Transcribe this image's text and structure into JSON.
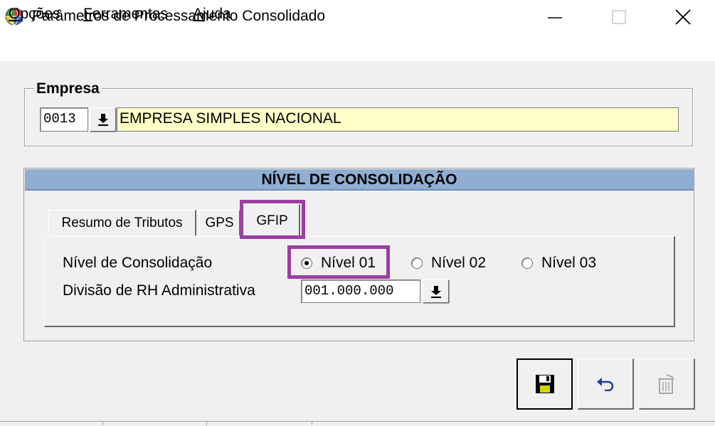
{
  "window": {
    "title": "Parâmetros de Processamento Consolidado",
    "icon": "globe-icon"
  },
  "menu": {
    "items": [
      {
        "first": "O",
        "rest": "pções"
      },
      {
        "first": "F",
        "rest": "erramentas"
      },
      {
        "first": "A",
        "rest": "juda"
      }
    ]
  },
  "empresa": {
    "legend": "Empresa",
    "code": "0013",
    "name": "EMPRESA SIMPLES NACIONAL",
    "lookup_icon": "download-arrow-icon"
  },
  "nivel": {
    "header": "NÍVEL DE CONSOLIDAÇÃO",
    "tabs": [
      "Resumo de Tributos",
      "GPS",
      "GFIP"
    ],
    "active_tab": "GFIP",
    "label_nivel": "Nível de Consolidação",
    "options": [
      "Nível 01",
      "Nível 02",
      "Nível 03"
    ],
    "selected_option": "Nível 01",
    "label_divisao": "Divisão de RH Administrativa",
    "divisao_value": "001.000.000"
  },
  "actions": {
    "save_icon": "floppy-disk-icon",
    "undo_icon": "undo-arrow-icon",
    "delete_icon": "trash-icon"
  },
  "colors": {
    "highlight": "#9b3fa3",
    "header_bg": "#8faed0",
    "name_field_bg": "#ffffc8"
  }
}
